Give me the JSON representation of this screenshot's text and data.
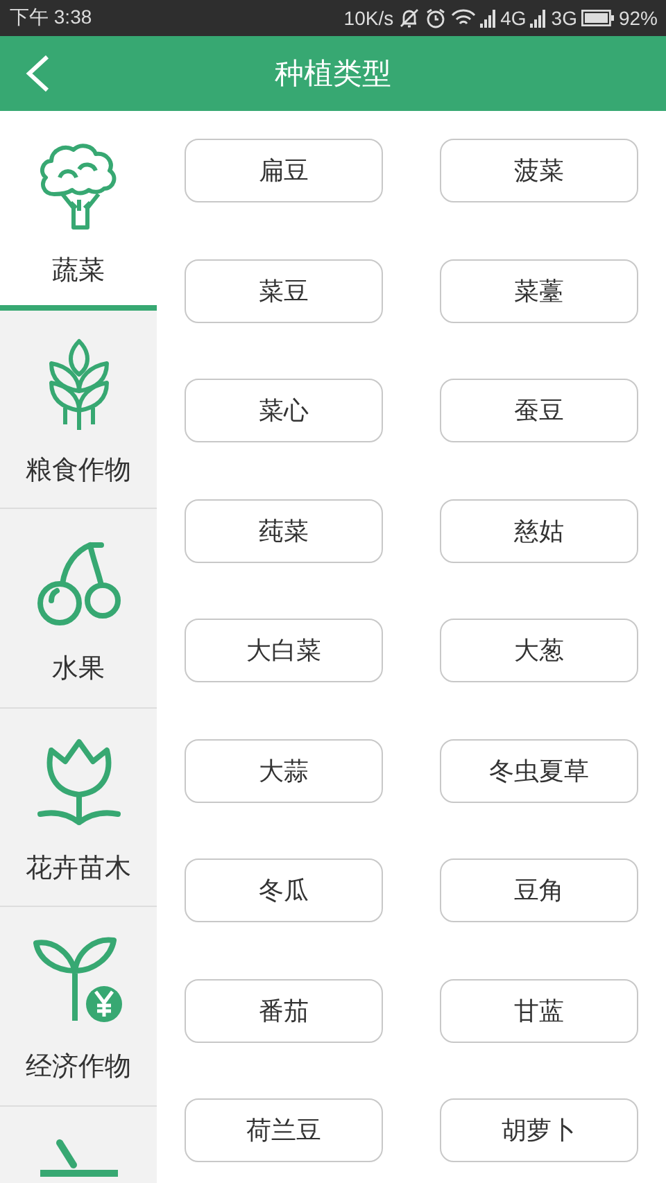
{
  "status_bar": {
    "time": "下午 3:38",
    "speed": "10K/s",
    "network_1": "4G",
    "network_2": "3G",
    "battery": "92%"
  },
  "header": {
    "title": "种植类型"
  },
  "sidebar": {
    "items": [
      {
        "kind": "broccoli",
        "label": "蔬菜",
        "selected": true
      },
      {
        "kind": "grain",
        "label": "粮食作物",
        "selected": false
      },
      {
        "kind": "cherry",
        "label": "水果",
        "selected": false
      },
      {
        "kind": "tulip",
        "label": "花卉苗木",
        "selected": false
      },
      {
        "kind": "sprout",
        "label": "经济作物",
        "selected": false
      },
      {
        "kind": "tool",
        "selected": false
      }
    ]
  },
  "crops": [
    "扁豆",
    "菠菜",
    "菜豆",
    "菜薹",
    "菜心",
    "蚕豆",
    "莼菜",
    "慈姑",
    "大白菜",
    "大葱",
    "大蒜",
    "冬虫夏草",
    "冬瓜",
    "豆角",
    "番茄",
    "甘蓝",
    "荷兰豆",
    "胡萝卜"
  ]
}
